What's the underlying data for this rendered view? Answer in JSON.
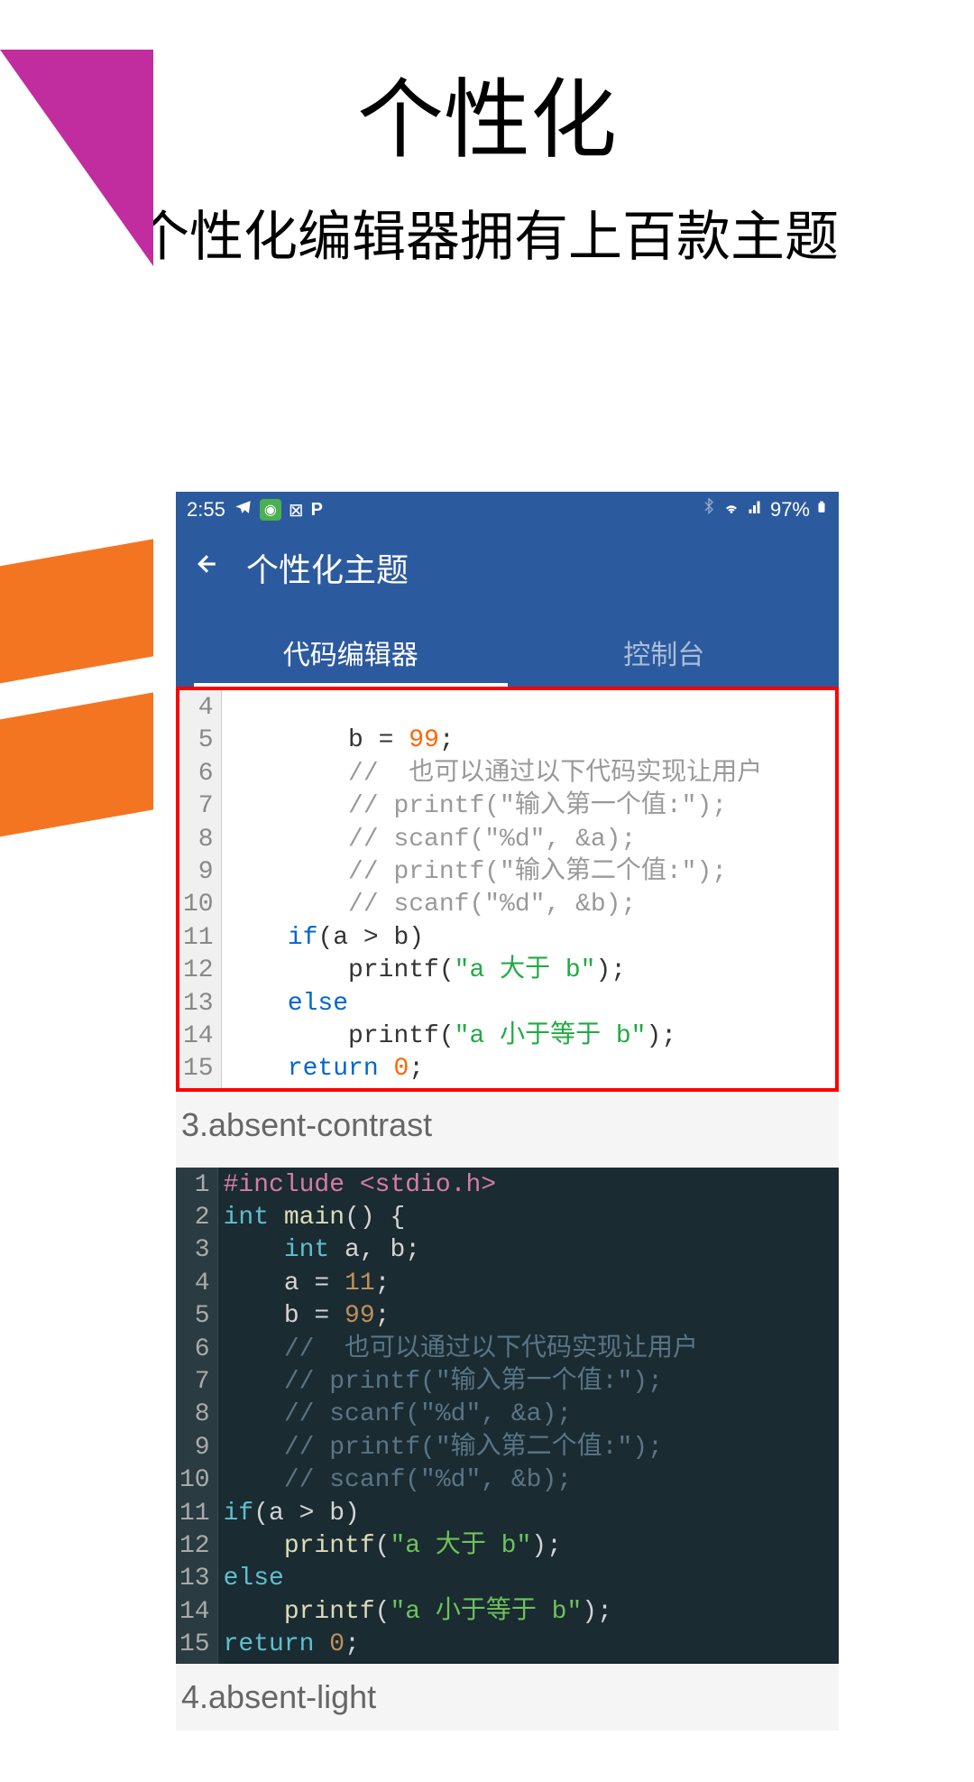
{
  "page": {
    "title": "个性化",
    "subtitle": "个性化编辑器拥有上百款主题"
  },
  "statusBar": {
    "time": "2:55",
    "battery": "97%"
  },
  "header": {
    "title": "个性化主题"
  },
  "tabs": {
    "tab1": "代码编辑器",
    "tab2": "控制台"
  },
  "codeLight": {
    "lines": [
      "4",
      "5",
      "6",
      "7",
      "8",
      "9",
      "10",
      "11",
      "12",
      "13",
      "14",
      "15"
    ],
    "content": [
      {
        "indent": "        ",
        "parts": [
          {
            "c": "lt-var",
            "t": "b"
          },
          {
            "c": "lt-op",
            "t": " = "
          },
          {
            "c": "lt-num",
            "t": "99"
          },
          {
            "c": "lt-op",
            "t": ";"
          }
        ]
      },
      {
        "indent": "        ",
        "parts": [
          {
            "c": "lt-comment",
            "t": "//  也可以通过以下代码实现让用户"
          }
        ]
      },
      {
        "indent": "        ",
        "parts": [
          {
            "c": "lt-comment",
            "t": "// printf(\"输入第一个值:\");"
          }
        ]
      },
      {
        "indent": "        ",
        "parts": [
          {
            "c": "lt-comment",
            "t": "// scanf(\"%d\", &a);"
          }
        ]
      },
      {
        "indent": "        ",
        "parts": [
          {
            "c": "lt-comment",
            "t": "// printf(\"输入第二个值:\");"
          }
        ]
      },
      {
        "indent": "        ",
        "parts": [
          {
            "c": "lt-comment",
            "t": "// scanf(\"%d\", &b);"
          }
        ]
      },
      {
        "indent": "    ",
        "parts": [
          {
            "c": "lt-kw",
            "t": "if"
          },
          {
            "c": "lt-op",
            "t": "(a > b)"
          }
        ]
      },
      {
        "indent": "        ",
        "parts": [
          {
            "c": "lt-fn",
            "t": "printf("
          },
          {
            "c": "lt-str",
            "t": "\"a 大于 b\""
          },
          {
            "c": "lt-op",
            "t": ");"
          }
        ]
      },
      {
        "indent": "    ",
        "parts": [
          {
            "c": "lt-kw",
            "t": "else"
          }
        ]
      },
      {
        "indent": "        ",
        "parts": [
          {
            "c": "lt-fn",
            "t": "printf("
          },
          {
            "c": "lt-str",
            "t": "\"a 小于等于 b\""
          },
          {
            "c": "lt-op",
            "t": ");"
          }
        ]
      },
      {
        "indent": "    ",
        "parts": [
          {
            "c": "lt-kw",
            "t": "return"
          },
          {
            "c": "lt-op",
            "t": " "
          },
          {
            "c": "lt-num",
            "t": "0"
          },
          {
            "c": "lt-op",
            "t": ";"
          }
        ]
      }
    ]
  },
  "theme3Label": "3.absent-contrast",
  "codeDark": {
    "lines": [
      "1",
      "2",
      "3",
      "4",
      "5",
      "6",
      "7",
      "8",
      "9",
      "10",
      "11",
      "12",
      "13",
      "14",
      "15"
    ],
    "content": [
      {
        "indent": "",
        "parts": [
          {
            "c": "dk-pre",
            "t": "#include <stdio.h>"
          }
        ]
      },
      {
        "indent": "",
        "parts": [
          {
            "c": "dk-kw",
            "t": "int"
          },
          {
            "c": "dk-var",
            "t": " "
          },
          {
            "c": "dk-fn",
            "t": "main"
          },
          {
            "c": "dk-op",
            "t": "() {"
          }
        ]
      },
      {
        "indent": "    ",
        "parts": [
          {
            "c": "dk-kw",
            "t": "int"
          },
          {
            "c": "dk-var",
            "t": " a, b;"
          }
        ]
      },
      {
        "indent": "    ",
        "parts": [
          {
            "c": "dk-var",
            "t": "a = "
          },
          {
            "c": "dk-num",
            "t": "11"
          },
          {
            "c": "dk-op",
            "t": ";"
          }
        ]
      },
      {
        "indent": "    ",
        "parts": [
          {
            "c": "dk-var",
            "t": "b = "
          },
          {
            "c": "dk-num",
            "t": "99"
          },
          {
            "c": "dk-op",
            "t": ";"
          }
        ]
      },
      {
        "indent": "    ",
        "parts": [
          {
            "c": "dk-comment",
            "t": "//  也可以通过以下代码实现让用户"
          }
        ]
      },
      {
        "indent": "    ",
        "parts": [
          {
            "c": "dk-comment",
            "t": "// printf(\"输入第一个值:\");"
          }
        ]
      },
      {
        "indent": "    ",
        "parts": [
          {
            "c": "dk-comment",
            "t": "// scanf(\"%d\", &a);"
          }
        ]
      },
      {
        "indent": "    ",
        "parts": [
          {
            "c": "dk-comment",
            "t": "// printf(\"输入第二个值:\");"
          }
        ]
      },
      {
        "indent": "    ",
        "parts": [
          {
            "c": "dk-comment",
            "t": "// scanf(\"%d\", &b);"
          }
        ]
      },
      {
        "indent": "",
        "parts": [
          {
            "c": "dk-kw",
            "t": "if"
          },
          {
            "c": "dk-op",
            "t": "(a > b)"
          }
        ]
      },
      {
        "indent": "    ",
        "parts": [
          {
            "c": "dk-fn",
            "t": "printf"
          },
          {
            "c": "dk-op",
            "t": "("
          },
          {
            "c": "dk-str",
            "t": "\"a 大于 b\""
          },
          {
            "c": "dk-op",
            "t": ");"
          }
        ]
      },
      {
        "indent": "",
        "parts": [
          {
            "c": "dk-kw",
            "t": "else"
          }
        ]
      },
      {
        "indent": "    ",
        "parts": [
          {
            "c": "dk-fn",
            "t": "printf"
          },
          {
            "c": "dk-op",
            "t": "("
          },
          {
            "c": "dk-str",
            "t": "\"a 小于等于 b\""
          },
          {
            "c": "dk-op",
            "t": ");"
          }
        ]
      },
      {
        "indent": "",
        "parts": [
          {
            "c": "dk-kw",
            "t": "return"
          },
          {
            "c": "dk-op",
            "t": " "
          },
          {
            "c": "dk-num",
            "t": "0"
          },
          {
            "c": "dk-op",
            "t": ";"
          }
        ]
      }
    ]
  },
  "theme4Label": "4.absent-light"
}
